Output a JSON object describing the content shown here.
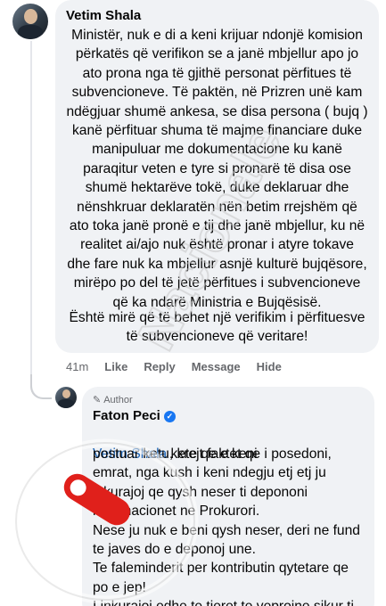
{
  "comment1": {
    "author": "Vetim Shala",
    "text": "Ministër, nuk e di a keni krijuar ndonjë komision\npërkatës që verifikon se a janë mbjellur apo jo\nato prona nga të gjithë personat përfitues të\nsubvencioneve. Të paktën, në Prizren unë kam\nndëgjuar shumë ankesa, se disa persona ( bujq )\nkanë përfituar shuma të majme financiare duke\nmanipuluar me dokumentacione ku kanë\nparaqitur veten e tyre si pronarë të disa ose\nshumë hektarëve tokë, duke deklaruar dhe\nnënshkruar deklaratën nën betim rrejshëm që\nato toka janë pronë e tij dhe janë mbjellur, ku në\nrealitet ai/ajo nuk është pronar i atyre tokave\ndhe fare nuk ka mbjellur asnjë kulturë bujqësore,\nmirëpo po del të jetë përfitues i subvencioneve\nqë ka ndarë Ministria e Bujqësisë.",
    "text2": "Është mirë që të behet një verifikim i përfituesve\ntë subvencioneve që veritare!",
    "time": "41m",
    "like": "Like",
    "reply": "Reply",
    "message": "Message",
    "hide": "Hide"
  },
  "comment2": {
    "badge": "Author",
    "author": "Faton Peci",
    "mention": "Vetim Shala",
    "text_first": " kete qe e keni",
    "text": "postuar ketu, krejt faktet qe i posedoni,\nemrat, nga kush i keni ndegju etj etj ju\ninkurajoj qe qysh neser ti depononi\ninformacionet ne Prokurori.\nNese ju nuk e beni qysh neser, deri ne fund\nte javes do e deponoj une.\nTe faleminderit per kontributin qytetare qe\npo e jep!\nI inkurajoj edhe te tjeret te veprojne sikur ti"
  },
  "watermark": {
    "text": "Nacionale"
  },
  "colors": {
    "bubble": "#f0f2f5",
    "meta": "#65676b",
    "mention": "#1d64b5",
    "verified": "#1877f2",
    "watermark_red": "#e0201b"
  }
}
